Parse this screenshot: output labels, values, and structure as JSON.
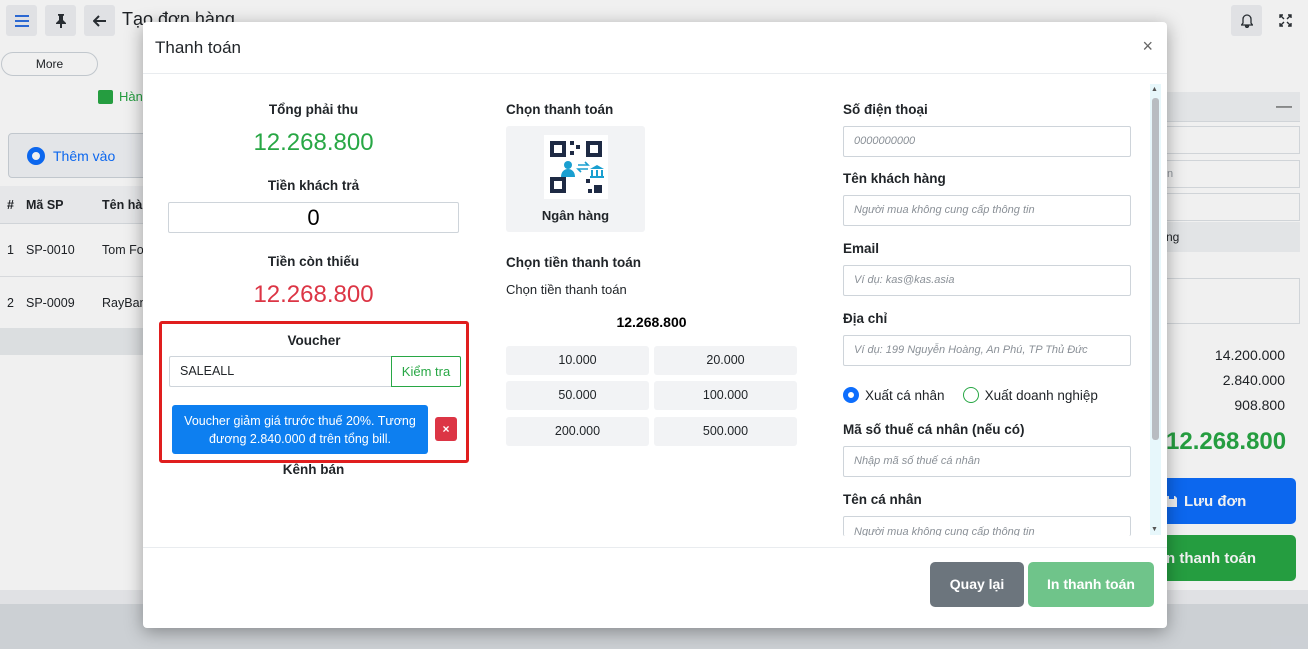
{
  "app": {
    "page_title": "Tạo đơn hàng",
    "more_label": "More",
    "hang_tab_label": "Hàn",
    "them_vao_label": "Thêm vào",
    "table": {
      "headers": [
        "#",
        "Mã SP",
        "Tên hàn"
      ],
      "rows": [
        [
          "1",
          "SP-0010",
          "Tom Fo"
        ],
        [
          "2",
          "SP-0009",
          "RayBan"
        ]
      ]
    },
    "right_panel": {
      "field_hint": "n",
      "ng_label": "ng",
      "amounts": [
        "14.200.000",
        "2.840.000",
        "908.800"
      ],
      "total": "12.268.800",
      "luu_don_label": "Lưu đơn",
      "in_thanh_toan_label": "n thanh toán"
    }
  },
  "modal": {
    "title": "Thanh toán",
    "close_glyph": "×",
    "summary": {
      "total_label": "Tổng phải thu",
      "total_value": "12.268.800",
      "paid_label": "Tiền khách trả",
      "paid_value": "0",
      "remaining_label": "Tiền còn thiếu",
      "remaining_value": "12.268.800"
    },
    "voucher": {
      "label": "Voucher",
      "code": "SALEALL",
      "check_label": "Kiểm tra",
      "info": "Voucher giảm giá trước thuế 20%. Tương đương 2.840.000 đ trên tổng bill.",
      "remove_glyph": "×"
    },
    "kenh_ban_label": "Kênh bán",
    "payment": {
      "choose_label": "Chọn thanh toán",
      "method_label": "Ngân hàng",
      "choose_amount_label": "Chọn tiền thanh toán",
      "choose_amount_hint": "Chọn tiền thanh toán",
      "amount": "12.268.800",
      "quick_amounts": [
        "10.000",
        "20.000",
        "50.000",
        "100.000",
        "200.000",
        "500.000"
      ]
    },
    "customer": {
      "phone_label": "Số điện thoại",
      "phone_placeholder": "0000000000",
      "name_label": "Tên khách hàng",
      "name_placeholder": "Người mua không cung cấp thông tin",
      "email_label": "Email",
      "email_placeholder": "Ví dụ: kas@kas.asia",
      "address_label": "Địa chỉ",
      "address_placeholder": "Ví dụ: 199 Nguyễn Hoàng, An Phú, TP Thủ Đức",
      "invoice_personal": "Xuất cá nhân",
      "invoice_business": "Xuất doanh nghiệp",
      "tax_label": "Mã số thuế cá nhân (nếu có)",
      "tax_placeholder": "Nhập mã số thuế cá nhân",
      "person_label": "Tên cá nhân",
      "person_placeholder": "Người mua không cung cấp thông tin"
    },
    "footer": {
      "back_label": "Quay lại",
      "print_label": "In thanh toán"
    }
  },
  "colors": {
    "green": "#28a745",
    "red": "#dc3545",
    "blue": "#0d6efd",
    "highlight": "#e01e1e"
  }
}
